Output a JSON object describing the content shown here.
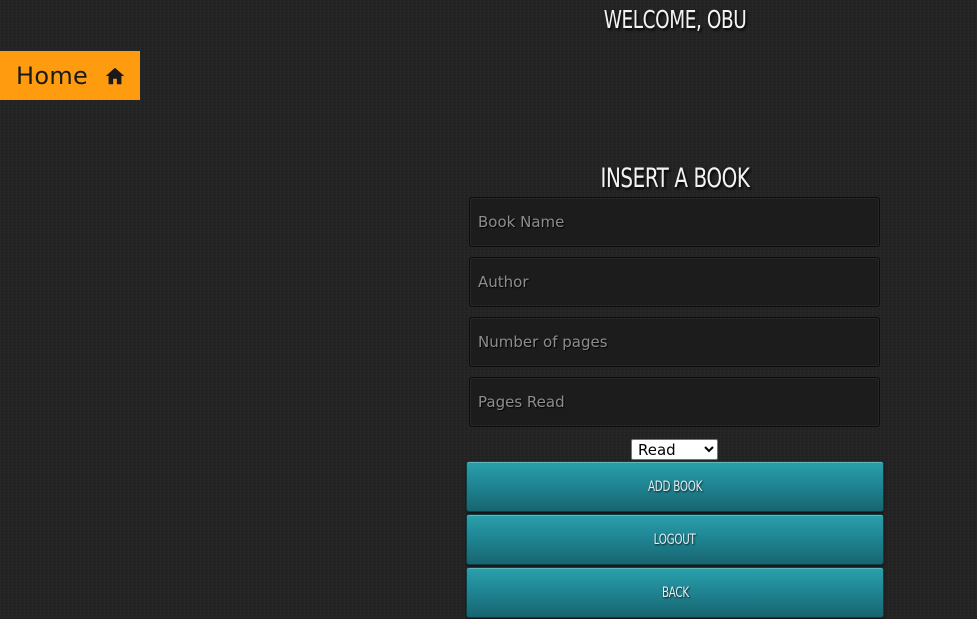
{
  "nav": {
    "home_label": "Home",
    "home_icon": "home-icon",
    "home_color": "#ff9b0f"
  },
  "header": {
    "welcome": "WELCOME, OBU"
  },
  "form": {
    "title": "INSERT A BOOK",
    "book_name_placeholder": "Book Name",
    "author_placeholder": "Author",
    "pages_placeholder": "Number of pages",
    "pages_read_placeholder": "Pages Read",
    "status_selected": "Read",
    "add_button": "ADD BOOK",
    "logout_button": "LOGOUT",
    "back_button": "BACK",
    "button_color": "#208694"
  }
}
